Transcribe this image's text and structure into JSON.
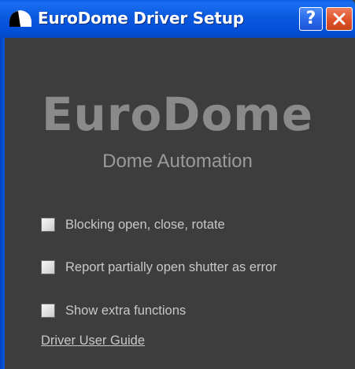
{
  "window": {
    "title": "EuroDome Driver Setup",
    "help_label": "?",
    "close_icon": "close-icon",
    "app_icon": "dome-icon"
  },
  "header": {
    "app_title": "EuroDome",
    "app_subtitle": "Dome Automation"
  },
  "options": [
    {
      "label": "Blocking open, close, rotate",
      "checked": false
    },
    {
      "label": "Report partially open shutter as error",
      "checked": false
    },
    {
      "label": "Show extra functions",
      "checked": false
    }
  ],
  "links": {
    "user_guide": "Driver User Guide"
  },
  "colors": {
    "background": "#3d3d3d",
    "title_bar": "#0b59de",
    "close_button": "#e1552d",
    "text": "#c8c8c8",
    "heading": "#8a8a8a"
  }
}
